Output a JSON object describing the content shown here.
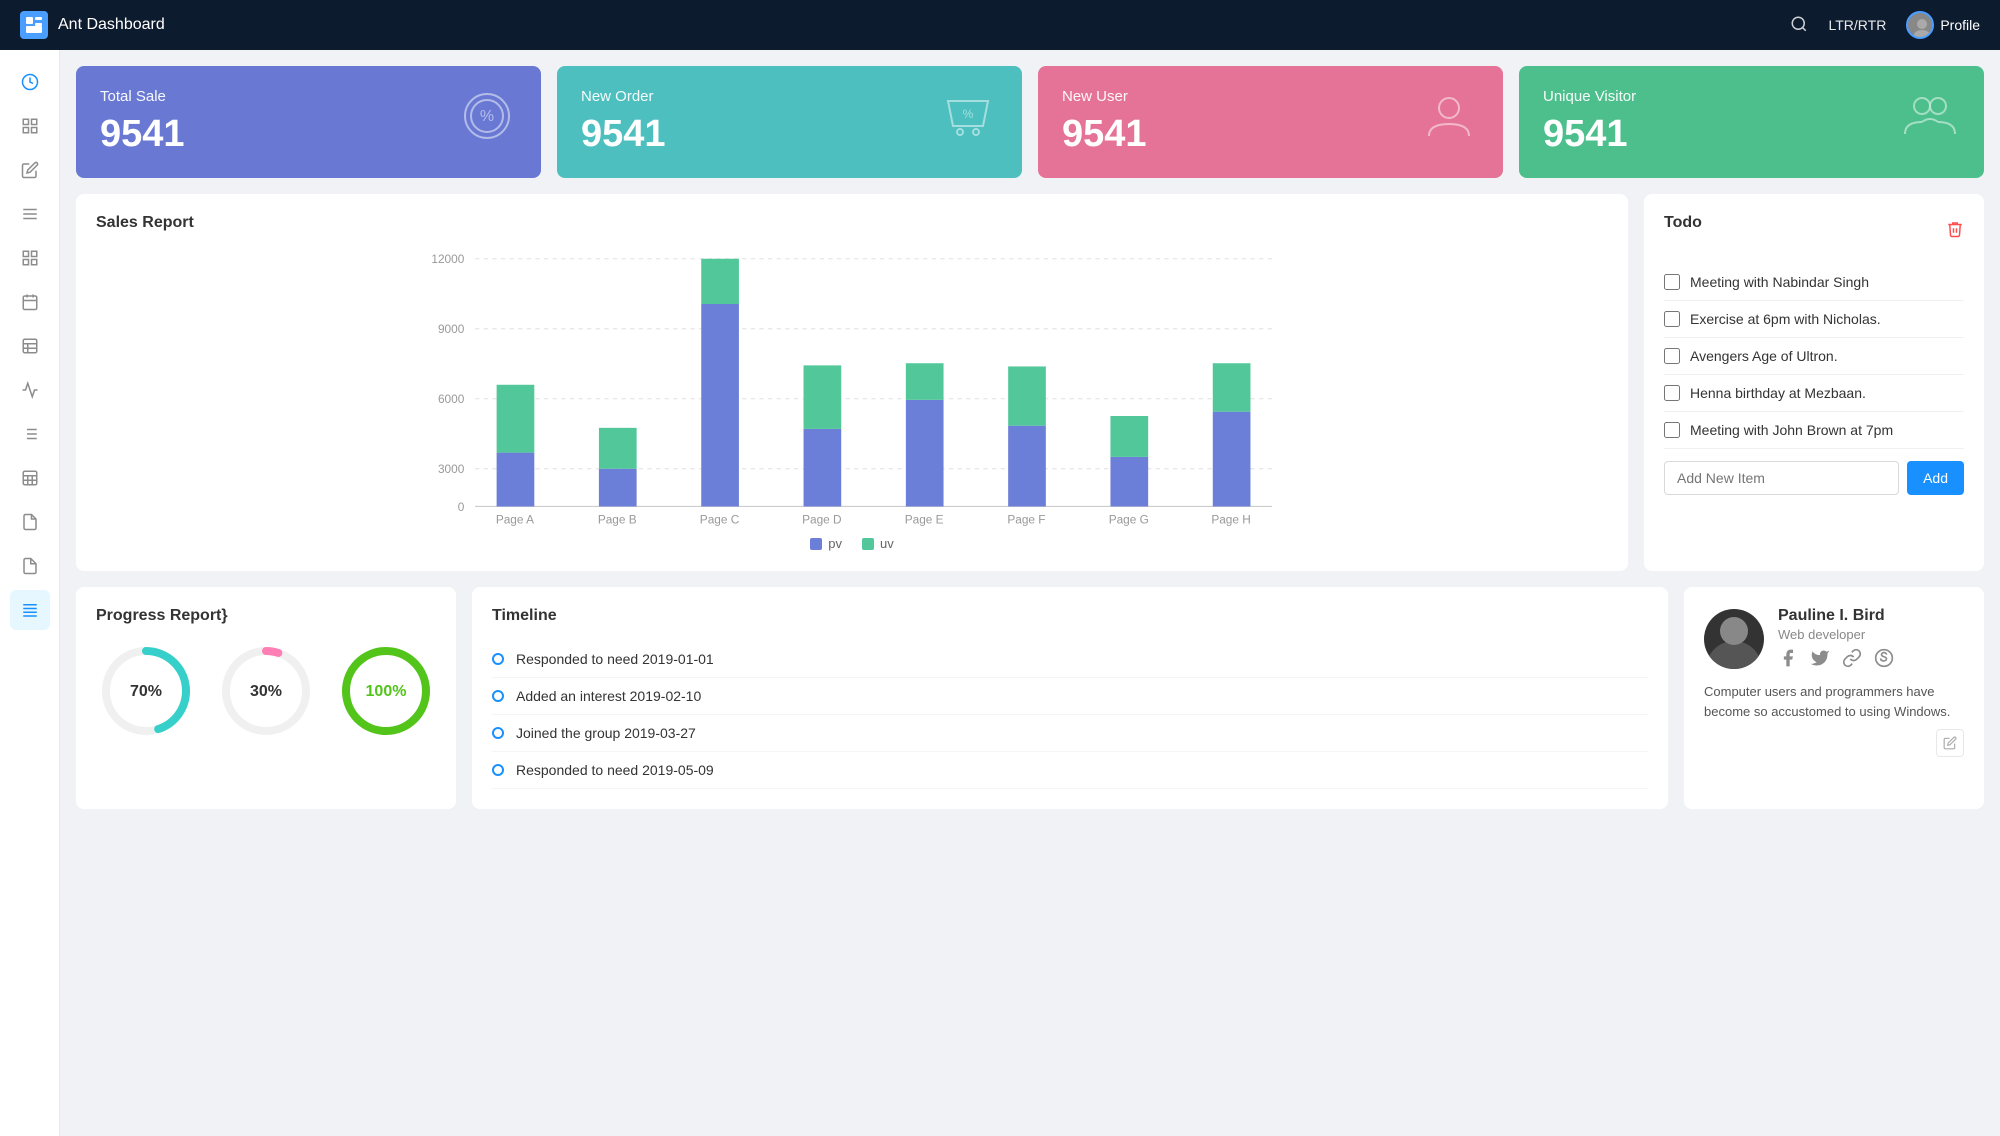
{
  "topbar": {
    "logo_label": "Ant Dashboard",
    "ltr_rtr_label": "LTR/RTR",
    "profile_label": "Profile"
  },
  "stats": [
    {
      "id": "total-sale",
      "title": "Total Sale",
      "value": "9541",
      "color": "stat-card-blue",
      "icon": "badge-percent"
    },
    {
      "id": "new-order",
      "title": "New Order",
      "value": "9541",
      "color": "stat-card-teal",
      "icon": "hand-coin"
    },
    {
      "id": "new-user",
      "title": "New User",
      "value": "9541",
      "color": "stat-card-pink",
      "icon": "person"
    },
    {
      "id": "unique-visitor",
      "title": "Unique Visitor",
      "value": "9541",
      "color": "stat-card-green",
      "icon": "person-group"
    }
  ],
  "sales_report": {
    "title": "Sales Report",
    "legend": {
      "pv": "pv",
      "uv": "uv"
    },
    "bars": [
      {
        "label": "Page A",
        "pv": 2400,
        "uv": 3800
      },
      {
        "label": "Page B",
        "pv": 1800,
        "uv": 2000
      },
      {
        "label": "Page C",
        "pv": 9000,
        "uv": 2800
      },
      {
        "label": "Page D",
        "pv": 3500,
        "uv": 2800
      },
      {
        "label": "Page E",
        "pv": 4800,
        "uv": 1600
      },
      {
        "label": "Page F",
        "pv": 3600,
        "uv": 2600
      },
      {
        "label": "Page G",
        "pv": 2200,
        "uv": 1800
      },
      {
        "label": "Page H",
        "pv": 4200,
        "uv": 2000
      }
    ],
    "y_labels": [
      "12000",
      "9000",
      "6000",
      "3000",
      "0"
    ]
  },
  "todo": {
    "title": "Todo",
    "items": [
      "Meeting with Nabindar Singh",
      "Exercise at 6pm with Nicholas.",
      "Avengers Age of Ultron.",
      "Henna birthday at Mezbaan.",
      "Meeting with John Brown at 7pm"
    ],
    "add_placeholder": "Add New Item",
    "add_button_label": "Add"
  },
  "progress_report": {
    "title": "Progress Report}",
    "circles": [
      {
        "percent": 70,
        "label": "70%",
        "color": "#36cfc9",
        "track": "#f0f0f0"
      },
      {
        "percent": 30,
        "label": "30%",
        "color": "#ff7eb3",
        "track": "#f0f0f0"
      },
      {
        "percent": 100,
        "label": "100%",
        "color": "#52c41a",
        "track": "#f0f0f0"
      }
    ]
  },
  "timeline": {
    "title": "Timeline",
    "items": [
      "Responded to need 2019-01-01",
      "Added an interest 2019-02-10",
      "Joined the group 2019-03-27",
      "Responded to need 2019-05-09"
    ]
  },
  "profile_card": {
    "name": "Pauline I. Bird",
    "role": "Web developer",
    "description": "Computer users and programmers have become so accustomed to using Windows.",
    "social_icons": [
      "facebook",
      "twitter",
      "link",
      "skype"
    ]
  },
  "sidebar": {
    "items": [
      {
        "id": "clock",
        "icon": "⊙"
      },
      {
        "id": "layout",
        "icon": "▦"
      },
      {
        "id": "edit",
        "icon": "✏"
      },
      {
        "id": "menu",
        "icon": "≡"
      },
      {
        "id": "grid",
        "icon": "⊞"
      },
      {
        "id": "calendar",
        "icon": "▤"
      },
      {
        "id": "table",
        "icon": "⊟"
      },
      {
        "id": "chart",
        "icon": "⌇"
      },
      {
        "id": "list",
        "icon": "☰"
      },
      {
        "id": "table2",
        "icon": "▣"
      },
      {
        "id": "doc",
        "icon": "▭"
      },
      {
        "id": "file",
        "icon": "☷"
      },
      {
        "id": "active-list",
        "icon": "≣",
        "active": true
      }
    ]
  }
}
